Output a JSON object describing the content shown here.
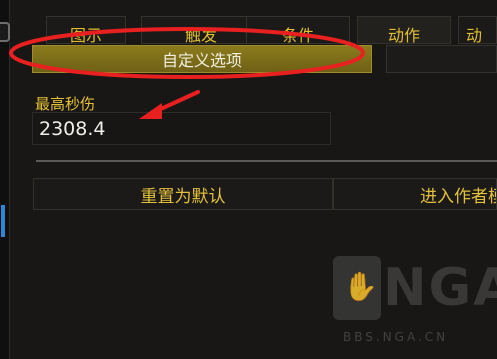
{
  "tabs": [
    {
      "label": "图示"
    },
    {
      "label": "触发"
    },
    {
      "label": "条件"
    },
    {
      "label": "动作"
    },
    {
      "label": "动画"
    }
  ],
  "subtabs": {
    "active_label": "自定义选项"
  },
  "field": {
    "label": "最高秒伤",
    "value": "2308.4"
  },
  "buttons": {
    "reset_label": "重置为默认",
    "author_mode_label": "进入作者模式"
  },
  "watermark": {
    "logo_text": "NGA",
    "url_text": "BBS.NGA.CN"
  },
  "colors": {
    "accent_gold": "#e1bf2f",
    "active_subtab": "#8b7a1c",
    "annotation_red": "#e8201f",
    "left_accent_blue": "#2e86d6"
  },
  "icons": {
    "watermark_icon": "bear-paw-icon",
    "annotation_arrow": "red-arrow-icon",
    "annotation_ellipse": "red-ellipse-highlight"
  }
}
